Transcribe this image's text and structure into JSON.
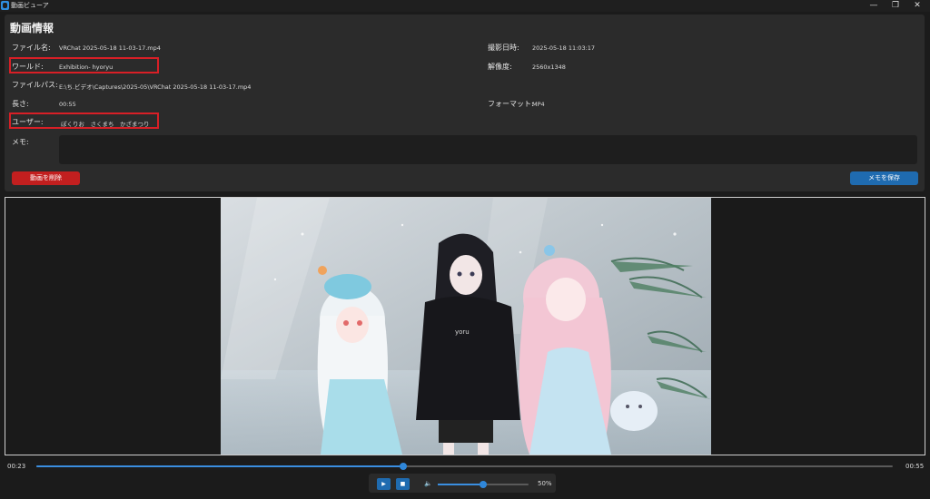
{
  "window": {
    "title": "動画ビューア",
    "minimize": "—",
    "maximize": "❐",
    "close": "✕"
  },
  "info": {
    "heading": "動画情報",
    "file_name_label": "ファイル名:",
    "file_name": "VRChat 2025-05-18 11-03-17.mp4",
    "world_label": "ワールド:",
    "world": "Exhibition- hyoryu",
    "file_path_label": "ファイルパス:",
    "file_path": "E:\\ち.ビデオ\\Captures\\2025-05\\VRChat 2025-05-18 11-03-17.mp4",
    "length_label": "長さ:",
    "length": "00:55",
    "users_label": "ユーザー:",
    "users": "ぽくりお　さくまち　かざまつり",
    "memo_label": "メモ:",
    "memo_value": "",
    "shot_date_label": "撮影日時:",
    "shot_date": "2025-05-18 11:03:17",
    "resolution_label": "解像度:",
    "resolution": "2560x1348",
    "format_label": "フォーマット:",
    "format": "MP4"
  },
  "buttons": {
    "delete": "動画を削除",
    "save_memo": "メモを保存"
  },
  "playback": {
    "current_time": "00:23",
    "duration": "00:55",
    "progress_fraction": 0.428,
    "play_icon": "play-icon",
    "stop_icon": "stop-icon",
    "volume_icon": "speaker-icon",
    "volume_percent": 50,
    "volume_label": "50%"
  },
  "colors": {
    "accent": "#1f6bb0",
    "danger": "#c21f1f",
    "highlight": "#d81f26"
  }
}
